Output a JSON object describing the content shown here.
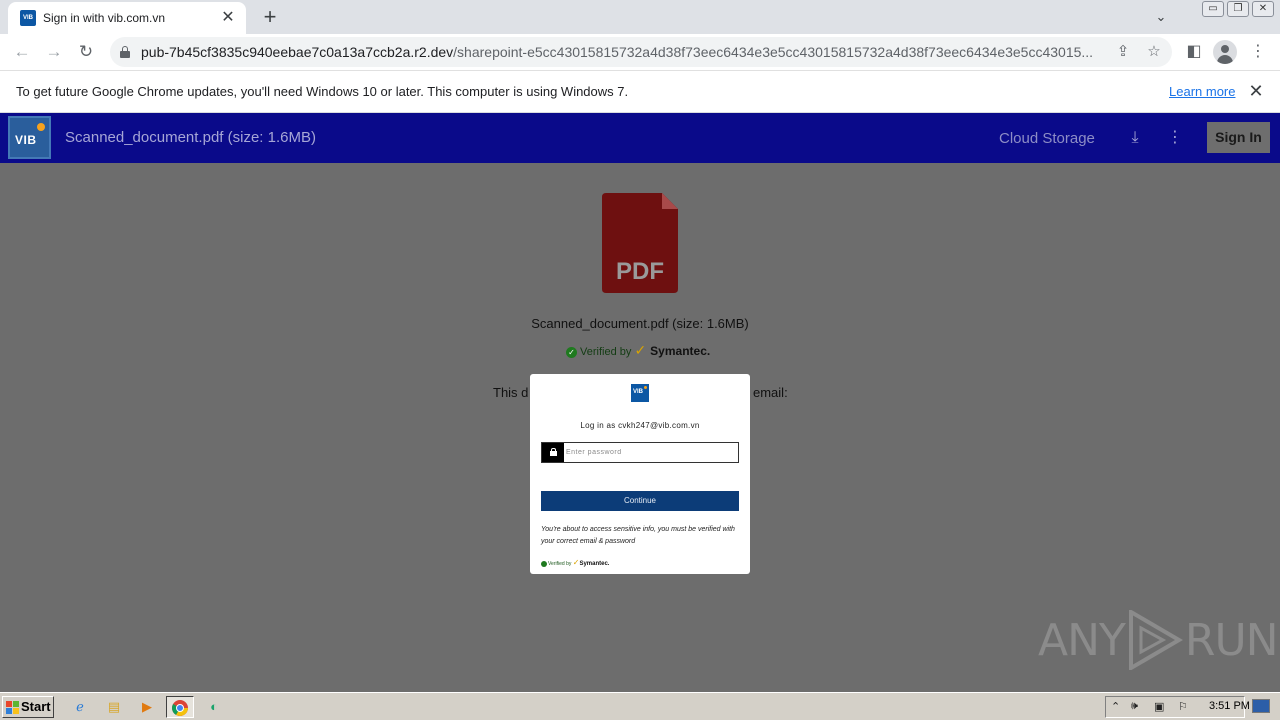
{
  "browser": {
    "tab_title": "Sign in with vib.com.vn",
    "tab_favicon": "VIB",
    "tab_close_icon": "close-icon",
    "new_tab_icon": "plus-icon",
    "url_host": "pub-7b45cf3835c940eebae7c0a13a7ccb2a.r2.dev",
    "url_path": "/sharepoint-e5cc43015815732a4d38f73eec6434e3e5cc43015815732a4d38f73eec6434e3e5cc43015...",
    "window_controls": [
      "▭",
      "❐",
      "✕"
    ]
  },
  "infobar": {
    "message": "To get future Google Chrome updates, you'll need Windows 10 or later. This computer is using Windows 7.",
    "link": "Learn more",
    "close": "✕"
  },
  "header": {
    "logo": "VIB",
    "title": "Scanned_document.pdf (size: 1.6MB)",
    "cloud_storage": "Cloud Storage",
    "sign_in": "Sign In",
    "bg_color": "#0a0a8a"
  },
  "document": {
    "icon_label": "PDF",
    "name": "Scanned_document.pdf (size: 1.6MB)",
    "verified_by": "Verified by",
    "verifier": "Symantec.",
    "this_doc_prefix": "This d",
    "email_suffix": "email:"
  },
  "modal": {
    "logo": "VIB",
    "login_as": "Log in as cvkh247@vib.com.vn",
    "password_placeholder": "Enter password",
    "continue": "Continue",
    "notice": "You're about to access sensitive info, you must be verified with your correct email & password",
    "verified_by": "Verified by",
    "verifier": "Symantec."
  },
  "watermark": {
    "left": "ANY",
    "right": "RUN"
  },
  "taskbar": {
    "start": "Start",
    "clock": "3:51 PM"
  }
}
